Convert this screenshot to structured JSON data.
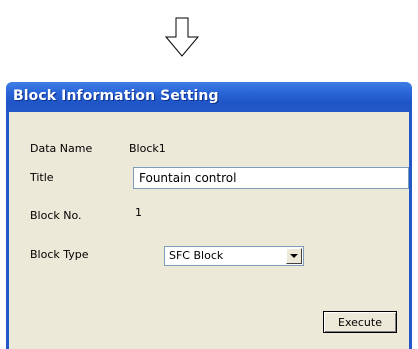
{
  "dialog": {
    "title": "Block Information Setting"
  },
  "fields": {
    "data_name_label": "Data Name",
    "data_name_value": "Block1",
    "title_label": "Title",
    "title_value": "Fountain control",
    "block_no_label": "Block No.",
    "block_no_value": "1",
    "block_type_label": "Block Type",
    "block_type_selected": "SFC Block"
  },
  "buttons": {
    "execute_label": "Execute"
  },
  "icons": {
    "flow_arrow": "down-arrow-icon",
    "combo_arrow": "chevron-down-icon"
  },
  "colors": {
    "titlebar": "#2358c8",
    "dialog_body": "#ece9d8",
    "input_border": "#7f9db9"
  }
}
